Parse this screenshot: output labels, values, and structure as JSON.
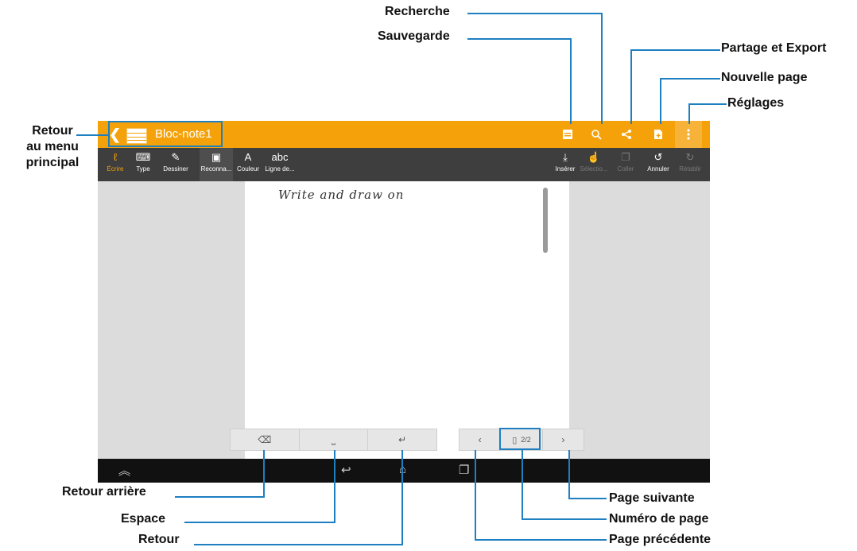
{
  "app": {
    "title": "Bloc-note1",
    "back_glyph": "❮",
    "icons": [
      "save-icon",
      "search-icon",
      "share-icon",
      "new-page-icon",
      "settings-icon"
    ]
  },
  "toolbar": {
    "ecrire": "Écrire",
    "type": "Type",
    "dessiner": "Dessiner",
    "reconnaissance": "Reconna...",
    "couleur": "Couleur",
    "ligne": "Ligne de...",
    "inserer": "Insérer",
    "selection": "Sélectio...",
    "coller": "Coller",
    "annuler": "Annuler",
    "retablir": "Rétablir"
  },
  "canvas": {
    "handwriting": "Write and draw on"
  },
  "pager": {
    "prev": "‹",
    "page_number": "2/2",
    "next": "›"
  },
  "keys": {
    "backspace": "⌫",
    "space": "⎵",
    "enter": "↵"
  },
  "callouts": {
    "recherche": "Recherche",
    "sauvegarde": "Sauvegarde",
    "partage": "Partage et Export",
    "nouvelle_page": "Nouvelle page",
    "reglages": "Réglages",
    "retour_menu_1": "Retour",
    "retour_menu_2": "au menu",
    "retour_menu_3": "principal",
    "retour_arriere": "Retour arrière",
    "espace": "Espace",
    "retour": "Retour",
    "page_suivante": "Page suivante",
    "numero_page": "Numéro de page",
    "page_precedente": "Page précédente"
  },
  "colors": {
    "accent": "#f5a20a",
    "toolbar": "#3e3e3e",
    "callout_line": "#1e7fc1"
  }
}
